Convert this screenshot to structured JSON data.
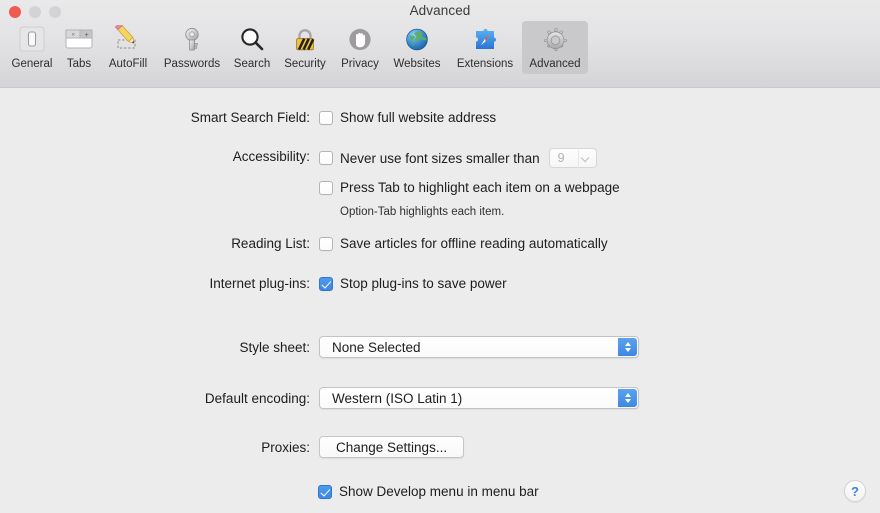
{
  "window": {
    "title": "Advanced",
    "traffic_lights": [
      "close",
      "minimize",
      "zoom"
    ]
  },
  "toolbar": {
    "tabs": [
      {
        "label": "General",
        "icon": "general-icon",
        "selected": false
      },
      {
        "label": "Tabs",
        "icon": "tabs-icon",
        "selected": false
      },
      {
        "label": "AutoFill",
        "icon": "autofill-icon",
        "selected": false
      },
      {
        "label": "Passwords",
        "icon": "passwords-icon",
        "selected": false
      },
      {
        "label": "Search",
        "icon": "search-icon",
        "selected": false
      },
      {
        "label": "Security",
        "icon": "security-icon",
        "selected": false
      },
      {
        "label": "Privacy",
        "icon": "privacy-icon",
        "selected": false
      },
      {
        "label": "Websites",
        "icon": "websites-icon",
        "selected": false
      },
      {
        "label": "Extensions",
        "icon": "extensions-icon",
        "selected": false
      },
      {
        "label": "Advanced",
        "icon": "advanced-icon",
        "selected": true
      }
    ]
  },
  "settings": {
    "smart_search_field": {
      "label": "Smart Search Field:",
      "show_full_address": {
        "text": "Show full website address",
        "checked": false
      }
    },
    "accessibility": {
      "label": "Accessibility:",
      "min_font_size": {
        "text": "Never use font sizes smaller than",
        "checked": false,
        "value": "9",
        "enabled": false
      },
      "press_tab": {
        "text": "Press Tab to highlight each item on a webpage",
        "checked": false
      },
      "hint": "Option-Tab highlights each item."
    },
    "reading_list": {
      "label": "Reading List:",
      "save_offline": {
        "text": "Save articles for offline reading automatically",
        "checked": false
      }
    },
    "internet_plugins": {
      "label": "Internet plug-ins:",
      "stop_plugins": {
        "text": "Stop plug-ins to save power",
        "checked": true
      }
    },
    "style_sheet": {
      "label": "Style sheet:",
      "value": "None Selected"
    },
    "default_encoding": {
      "label": "Default encoding:",
      "value": "Western (ISO Latin 1)"
    },
    "proxies": {
      "label": "Proxies:",
      "button": "Change Settings..."
    },
    "develop_menu": {
      "text": "Show Develop menu in menu bar",
      "checked": true
    }
  },
  "help": {
    "glyph": "?"
  },
  "colors": {
    "accent": "#3d87e3",
    "toolbar_top": "#eae9ea",
    "toolbar_bottom": "#d5d4d6",
    "content_bg": "#ececec",
    "close_button": "#f05b4f",
    "inactive_button": "#d3d2d4"
  }
}
